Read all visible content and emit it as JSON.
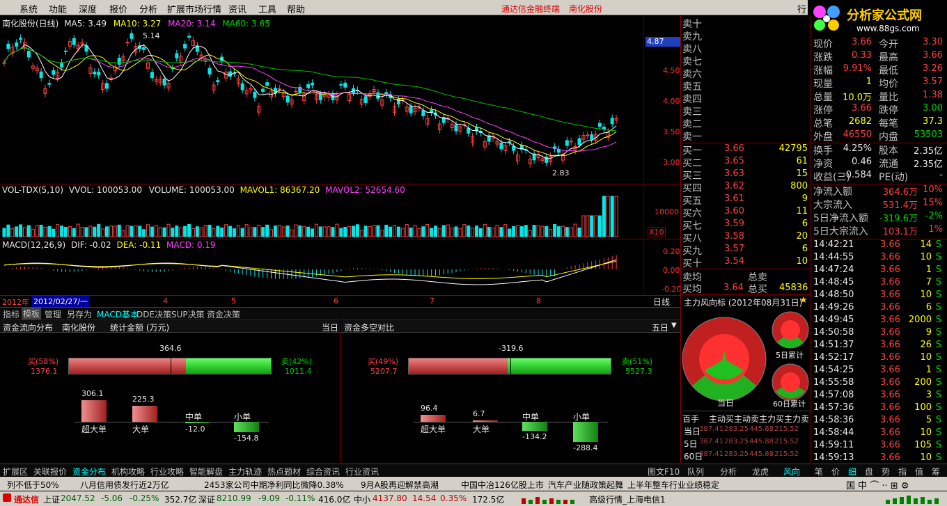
{
  "menu": [
    "系统",
    "功能",
    "深度",
    "报价",
    "分析",
    "扩展市场行情",
    "资讯",
    "工具",
    "帮助"
  ],
  "menu_title": "通达信金融终端",
  "menu_stock": "南化股份",
  "menu_right": "行",
  "logo_text": "分析家公式网",
  "logo_url": "www.88gs.com",
  "chart_header": {
    "name": "南化股份(日线)",
    "ma5": "MA5: 3.49",
    "ma10": "MA10: 3.27",
    "ma20": "MA20: 3.14",
    "ma60": "MA60: 3.65"
  },
  "price_axis": [
    "4.87",
    "4.50",
    "4.00",
    "3.50",
    "3.00"
  ],
  "annotations": {
    "high": "5.14",
    "low": "2.83"
  },
  "vol_header": {
    "name": "VOL-TDX(5,10)",
    "vvol": "VVOL: 100053.00",
    "volume": "VOLUME: 100053.00",
    "mavol1": "MAVOL1: 86367.20",
    "mavol2": "MAVOL2: 52654.60"
  },
  "vol_axis": [
    "10000",
    "X10"
  ],
  "macd_header": {
    "name": "MACD(12,26,9)",
    "dif": "DIF: -0.02",
    "dea": "DEA: -0.11",
    "macd": "MACD: 0.19"
  },
  "macd_axis": [
    "0.20",
    "0.00",
    "-0.20"
  ],
  "date_axis": {
    "year": "2012年",
    "date": "2012/02/27/一",
    "months": [
      "4",
      "5",
      "6",
      "7",
      "8"
    ],
    "period": "日线"
  },
  "chart_tabs": [
    "指标",
    "模板",
    "管理",
    "另存为",
    "MACD基本",
    "DDE决策",
    "SUP决策",
    "资金决策"
  ],
  "flow_left": {
    "title": "资金流向分布",
    "stock": "南化股份",
    "unit": "统计金额 (万元)",
    "period": "当日",
    "net": "364.6",
    "buy_label": "买(58%)",
    "buy": "1376.1",
    "sell_label": "卖(42%)",
    "sell": "1011.4",
    "bars": [
      {
        "label": "超大单",
        "value": "306.1"
      },
      {
        "label": "大单",
        "value": "225.3"
      },
      {
        "label": "中单",
        "value": "-12.0"
      },
      {
        "label": "小单",
        "value": "-154.8"
      }
    ]
  },
  "flow_right": {
    "title": "资金多空对比",
    "period": "五日",
    "net": "-319.6",
    "buy_label": "买(49%)",
    "buy": "5207.7",
    "sell_label": "卖(51%)",
    "sell": "5527.3",
    "bars": [
      {
        "label": "超大单",
        "value": "96.4"
      },
      {
        "label": "大单",
        "value": "6.7"
      },
      {
        "label": "中单",
        "value": "-134.2"
      },
      {
        "label": "小单",
        "value": "-288.4"
      }
    ]
  },
  "bottom_tabs": [
    "扩展区",
    "关联报价",
    "资金分布",
    "机构攻略",
    "行业攻略",
    "智能解盘",
    "主力轨迹",
    "热点题材",
    "综合资讯",
    "行业资讯"
  ],
  "bottom_right_tab": "图文F10",
  "orderbook_sell": [
    {
      "n": "卖十"
    },
    {
      "n": "卖九"
    },
    {
      "n": "卖八"
    },
    {
      "n": "卖七"
    },
    {
      "n": "卖六"
    },
    {
      "n": "卖五"
    },
    {
      "n": "卖四"
    },
    {
      "n": "卖三"
    },
    {
      "n": "卖二"
    },
    {
      "n": "卖一"
    }
  ],
  "orderbook_buy": [
    {
      "n": "买一",
      "p": "3.66",
      "v": "42795"
    },
    {
      "n": "买二",
      "p": "3.65",
      "v": "61"
    },
    {
      "n": "买三",
      "p": "3.63",
      "v": "15"
    },
    {
      "n": "买四",
      "p": "3.62",
      "v": "800"
    },
    {
      "n": "买五",
      "p": "3.61",
      "v": "9"
    },
    {
      "n": "买六",
      "p": "3.60",
      "v": "11"
    },
    {
      "n": "买七",
      "p": "3.59",
      "v": "6"
    },
    {
      "n": "买八",
      "p": "3.58",
      "v": "20"
    },
    {
      "n": "买九",
      "p": "3.57",
      "v": "6"
    },
    {
      "n": "买十",
      "p": "3.54",
      "v": "10"
    }
  ],
  "orderbook_summary": {
    "sell_avg": "卖均",
    "sell_total": "总卖",
    "buy_avg": "买均",
    "buy_avg_val": "3.64",
    "buy_total": "总买",
    "buy_total_val": "45836"
  },
  "quote": [
    [
      "现价",
      "3.66",
      "今开",
      "3.30"
    ],
    [
      "涨跌",
      "0.33",
      "最高",
      "3.66"
    ],
    [
      "涨幅",
      "9.91%",
      "最低",
      "3.26"
    ],
    [
      "现量",
      "1",
      "均价",
      "3.57"
    ],
    [
      "总量",
      "10.0万",
      "量比",
      "1.38"
    ],
    [
      "涨停",
      "3.66",
      "跌停",
      "3.00"
    ],
    [
      "总笔",
      "2682",
      "每笔",
      "37.3"
    ],
    [
      "外盘",
      "46550",
      "内盘",
      "53503"
    ]
  ],
  "quote2": [
    [
      "换手",
      "4.25%",
      "股本",
      "2.35亿"
    ],
    [
      "净资",
      "0.46",
      "流通",
      "2.35亿"
    ],
    [
      "收益(三)",
      "-0.584",
      "PE(动)",
      "-"
    ]
  ],
  "flow_quote": [
    [
      "净流入额",
      "364.6万",
      "10%"
    ],
    [
      "大宗流入",
      "531.4万",
      "15%"
    ],
    [
      "5日净流入额",
      "-319.6万",
      "-2%"
    ],
    [
      "5日大宗流入",
      "103.1万",
      "1%"
    ]
  ],
  "ticks": [
    [
      "14:42:21",
      "3.66",
      "14",
      "S"
    ],
    [
      "14:44:55",
      "3.66",
      "10",
      "S"
    ],
    [
      "14:47:24",
      "3.66",
      "1",
      "S"
    ],
    [
      "14:48:45",
      "3.66",
      "7",
      "S"
    ],
    [
      "14:48:50",
      "3.66",
      "10",
      "S"
    ],
    [
      "14:49:26",
      "3.66",
      "6",
      "S"
    ],
    [
      "14:49:45",
      "3.66",
      "2000",
      "S"
    ],
    [
      "14:50:58",
      "3.66",
      "9",
      "S"
    ],
    [
      "14:51:37",
      "3.66",
      "26",
      "S"
    ],
    [
      "14:52:17",
      "3.66",
      "10",
      "S"
    ],
    [
      "14:54:25",
      "3.66",
      "1",
      "S"
    ],
    [
      "14:55:58",
      "3.66",
      "200",
      "S"
    ],
    [
      "14:57:08",
      "3.66",
      "3",
      "S"
    ],
    [
      "14:57:36",
      "3.66",
      "100",
      "S"
    ],
    [
      "14:58:36",
      "3.66",
      "5",
      "S"
    ],
    [
      "14:58:44",
      "3.66",
      "10",
      "S"
    ],
    [
      "14:59:11",
      "3.66",
      "105",
      "S"
    ],
    [
      "14:59:13",
      "3.66",
      "10",
      "S"
    ]
  ],
  "indicator": {
    "title": "主力风向标 (2012年08月31日)",
    "today": "当日",
    "d5": "5日累计",
    "d60": "60日累计"
  },
  "indicator_table": {
    "headers": [
      "百手",
      "主动买",
      "主动卖",
      "主力买",
      "主力卖"
    ],
    "rows": [
      [
        "当日",
        "387.41",
        "283.25",
        "445.88",
        "215.52"
      ],
      [
        "5日",
        "387.41",
        "283.25",
        "445.88",
        "215.52"
      ],
      [
        "60日",
        "387.41",
        "283.25",
        "445.88",
        "215.52"
      ]
    ]
  },
  "right_tabs": [
    "队列",
    "分析",
    "龙虎",
    "风向"
  ],
  "far_right_tabs": [
    "笔",
    "价",
    "细",
    "盘",
    "势",
    "指",
    "值",
    "筹"
  ],
  "news": [
    "列不低于50%",
    "八月信用债发行近2万亿",
    "2453家公司中期净利同比微降0.38%",
    "9月A股再迎解禁高潮",
    "中国中冶126亿股上市",
    "汽车产业随政策起舞",
    "上半年整车行业业绩稳定"
  ],
  "status": {
    "brand": "通达信",
    "sh_name": "上证",
    "sh": "2047.52",
    "sh_chg": "-5.06",
    "sh_pct": "-0.25%",
    "sh_amt": "352.7亿",
    "sz_name": "深证",
    "sz": "8210.99",
    "sz_chg": "-9.09",
    "sz_pct": "-0.11%",
    "sz_amt": "416.0亿",
    "zx_name": "中小",
    "zx": "4137.80",
    "zx_chg": "14.54",
    "zx_pct": "0.35%",
    "zx_amt": "172.5亿",
    "server": "高级行情_上海电信1"
  },
  "colors": {
    "up": "#ff4040",
    "down": "#00d000",
    "bg": "#000000",
    "border": "#8b0000"
  }
}
